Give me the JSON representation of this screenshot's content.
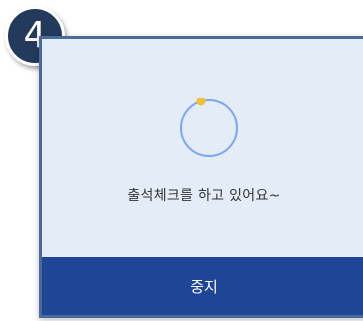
{
  "step_badge": {
    "number": "4",
    "color": "#243a5c"
  },
  "dialog": {
    "background": "#e4ecf8",
    "spinner_icon": "loading-spinner",
    "spinner_ring_color": "#7aa6f5",
    "spinner_dot_color": "#f2c030",
    "message": "출석체크를 하고 있어요~",
    "stop_button_label": "중지",
    "stop_button_color": "#1f4696"
  }
}
